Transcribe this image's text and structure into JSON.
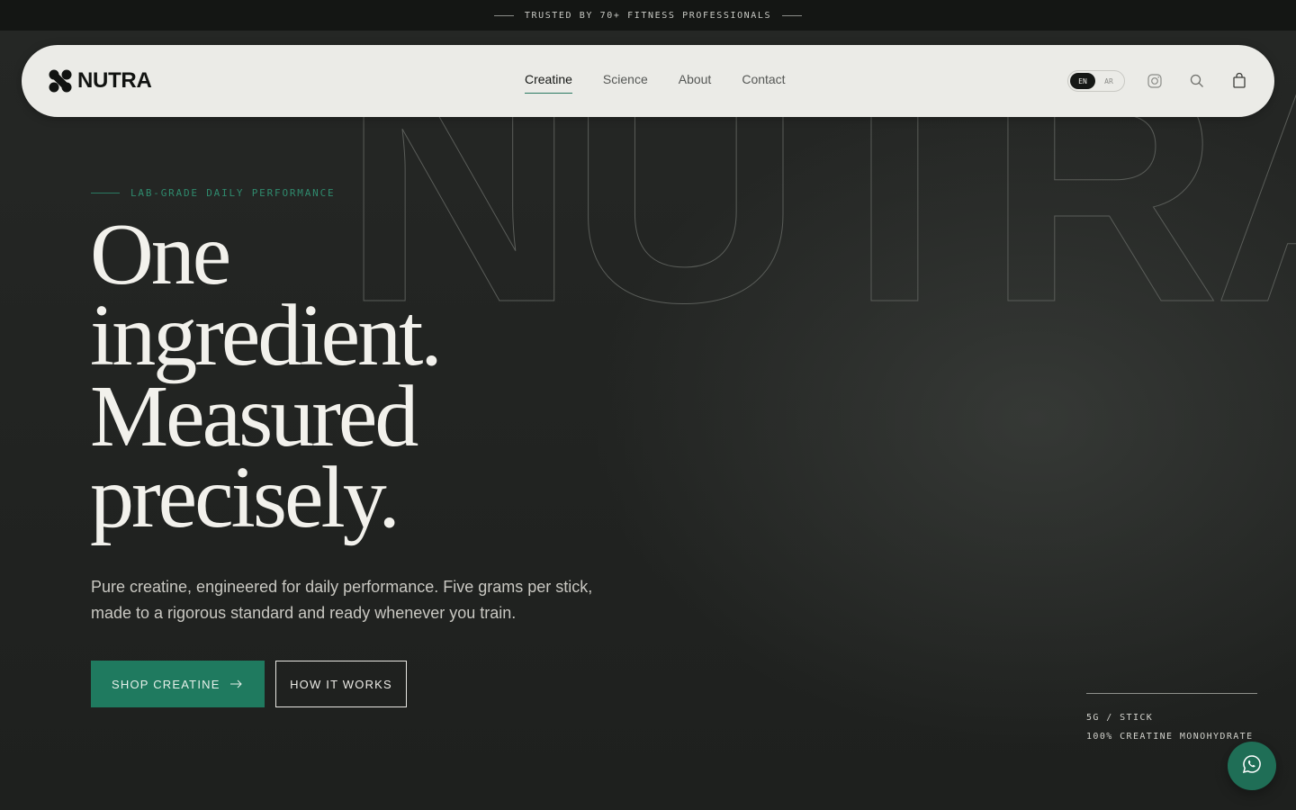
{
  "announcement": {
    "text": "TRUSTED BY 70+ FITNESS PROFESSIONALS"
  },
  "nav": {
    "logo_text": "NUTRA",
    "links": [
      {
        "label": "Creatine",
        "active": true
      },
      {
        "label": "Science",
        "active": false
      },
      {
        "label": "About",
        "active": false
      },
      {
        "label": "Contact",
        "active": false
      }
    ],
    "lang_en": "EN",
    "lang_ar": "AR",
    "icons": [
      "instagram-icon",
      "search-icon",
      "bag-icon"
    ]
  },
  "hero": {
    "background_word": "NUTRA",
    "eyebrow": "LAB-GRADE DAILY PERFORMANCE",
    "headline_lines": [
      "One",
      "ingredient.",
      "Measured",
      "precisely."
    ],
    "subtext": "Pure creatine, engineered for daily performance. Five grams per stick, made to a rigorous standard and ready whenever you train.",
    "primary_cta": "SHOP CREATINE",
    "secondary_cta": "HOW IT WORKS"
  },
  "spec": {
    "line1": "5G / STICK",
    "line2": "100% CREATINE MONOHYDRATE"
  },
  "colors": {
    "accent": "#1f7a5f",
    "background": "#1f211f",
    "nav_background": "#ebebe7"
  }
}
